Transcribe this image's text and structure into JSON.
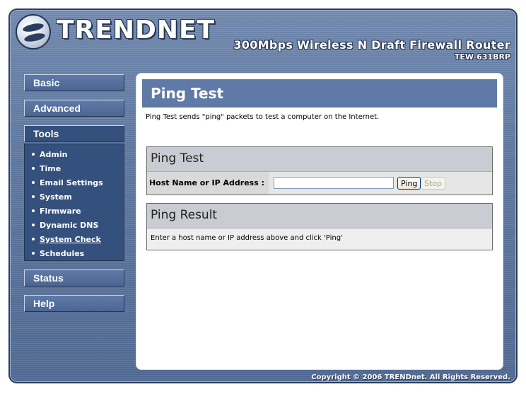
{
  "header": {
    "logo_text": "TRENDNET",
    "product_name": "300Mbps Wireless N Draft Firewall Router",
    "model": "TEW-631BRP"
  },
  "sidebar": {
    "basic": "Basic",
    "advanced": "Advanced",
    "tools": "Tools",
    "tools_items": [
      "Admin",
      "Time",
      "Email Settings",
      "System",
      "Firmware",
      "Dynamic DNS",
      "System Check",
      "Schedules"
    ],
    "status": "Status",
    "help": "Help"
  },
  "main": {
    "title": "Ping Test",
    "description": "Ping Test sends \"ping\" packets to test a computer on the Internet.",
    "ping_section": {
      "heading": "Ping Test",
      "host_label": "Host Name or IP Address :",
      "host_value": "",
      "ping_button": "Ping",
      "stop_button": "Stop"
    },
    "result_section": {
      "heading": "Ping Result",
      "message": "Enter a host name or IP address above and click 'Ping'"
    }
  },
  "footer": {
    "copyright": "Copyright © 2006 TRENDnet. All Rights Reserved."
  },
  "colors": {
    "frame": "#5d769d",
    "title_bar": "#5f7aa6",
    "submenu": "#34507c"
  }
}
